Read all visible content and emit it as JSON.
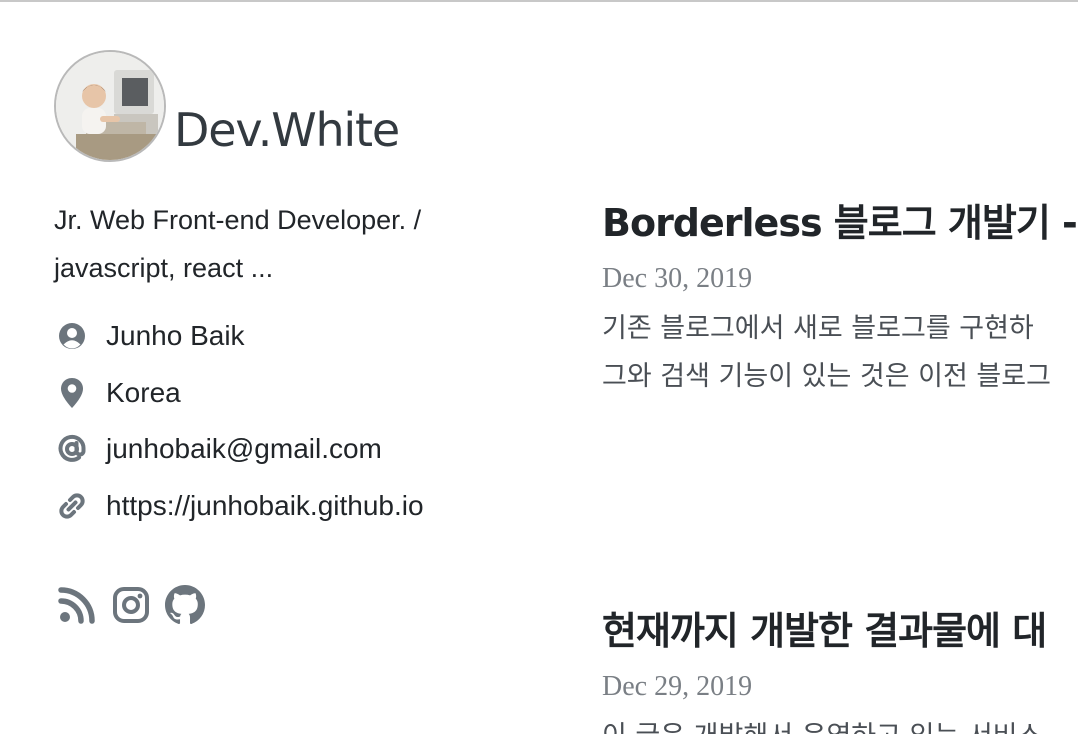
{
  "site": {
    "title": "Dev.White"
  },
  "profile": {
    "bio_lines": [
      "Jr. Web Front-end Developer. /",
      "javascript, react ..."
    ],
    "name": "Junho Baik",
    "location": "Korea",
    "email": "junhobaik@gmail.com",
    "website": "https://junhobaik.github.io"
  },
  "icons": {
    "name": "user-circle-icon",
    "location": "map-marker-icon",
    "email": "at-icon",
    "website": "link-icon",
    "rss": "rss-icon",
    "instagram": "instagram-icon",
    "github": "github-icon",
    "color": "#6c757d"
  },
  "posts": [
    {
      "title": "Borderless 블로그 개발기 -",
      "date": "Dec 30, 2019",
      "excerpt_lines": [
        "기존 블로그에서 새로 블로그를 구현하",
        "그와 검색 기능이 있는 것은 이전 블로그"
      ]
    },
    {
      "title": "현재까지 개발한 결과물에 대",
      "date": "Dec 29, 2019",
      "excerpt_lines": [
        "이 글은 개발해서 운영하고 있는 서비스"
      ]
    }
  ]
}
